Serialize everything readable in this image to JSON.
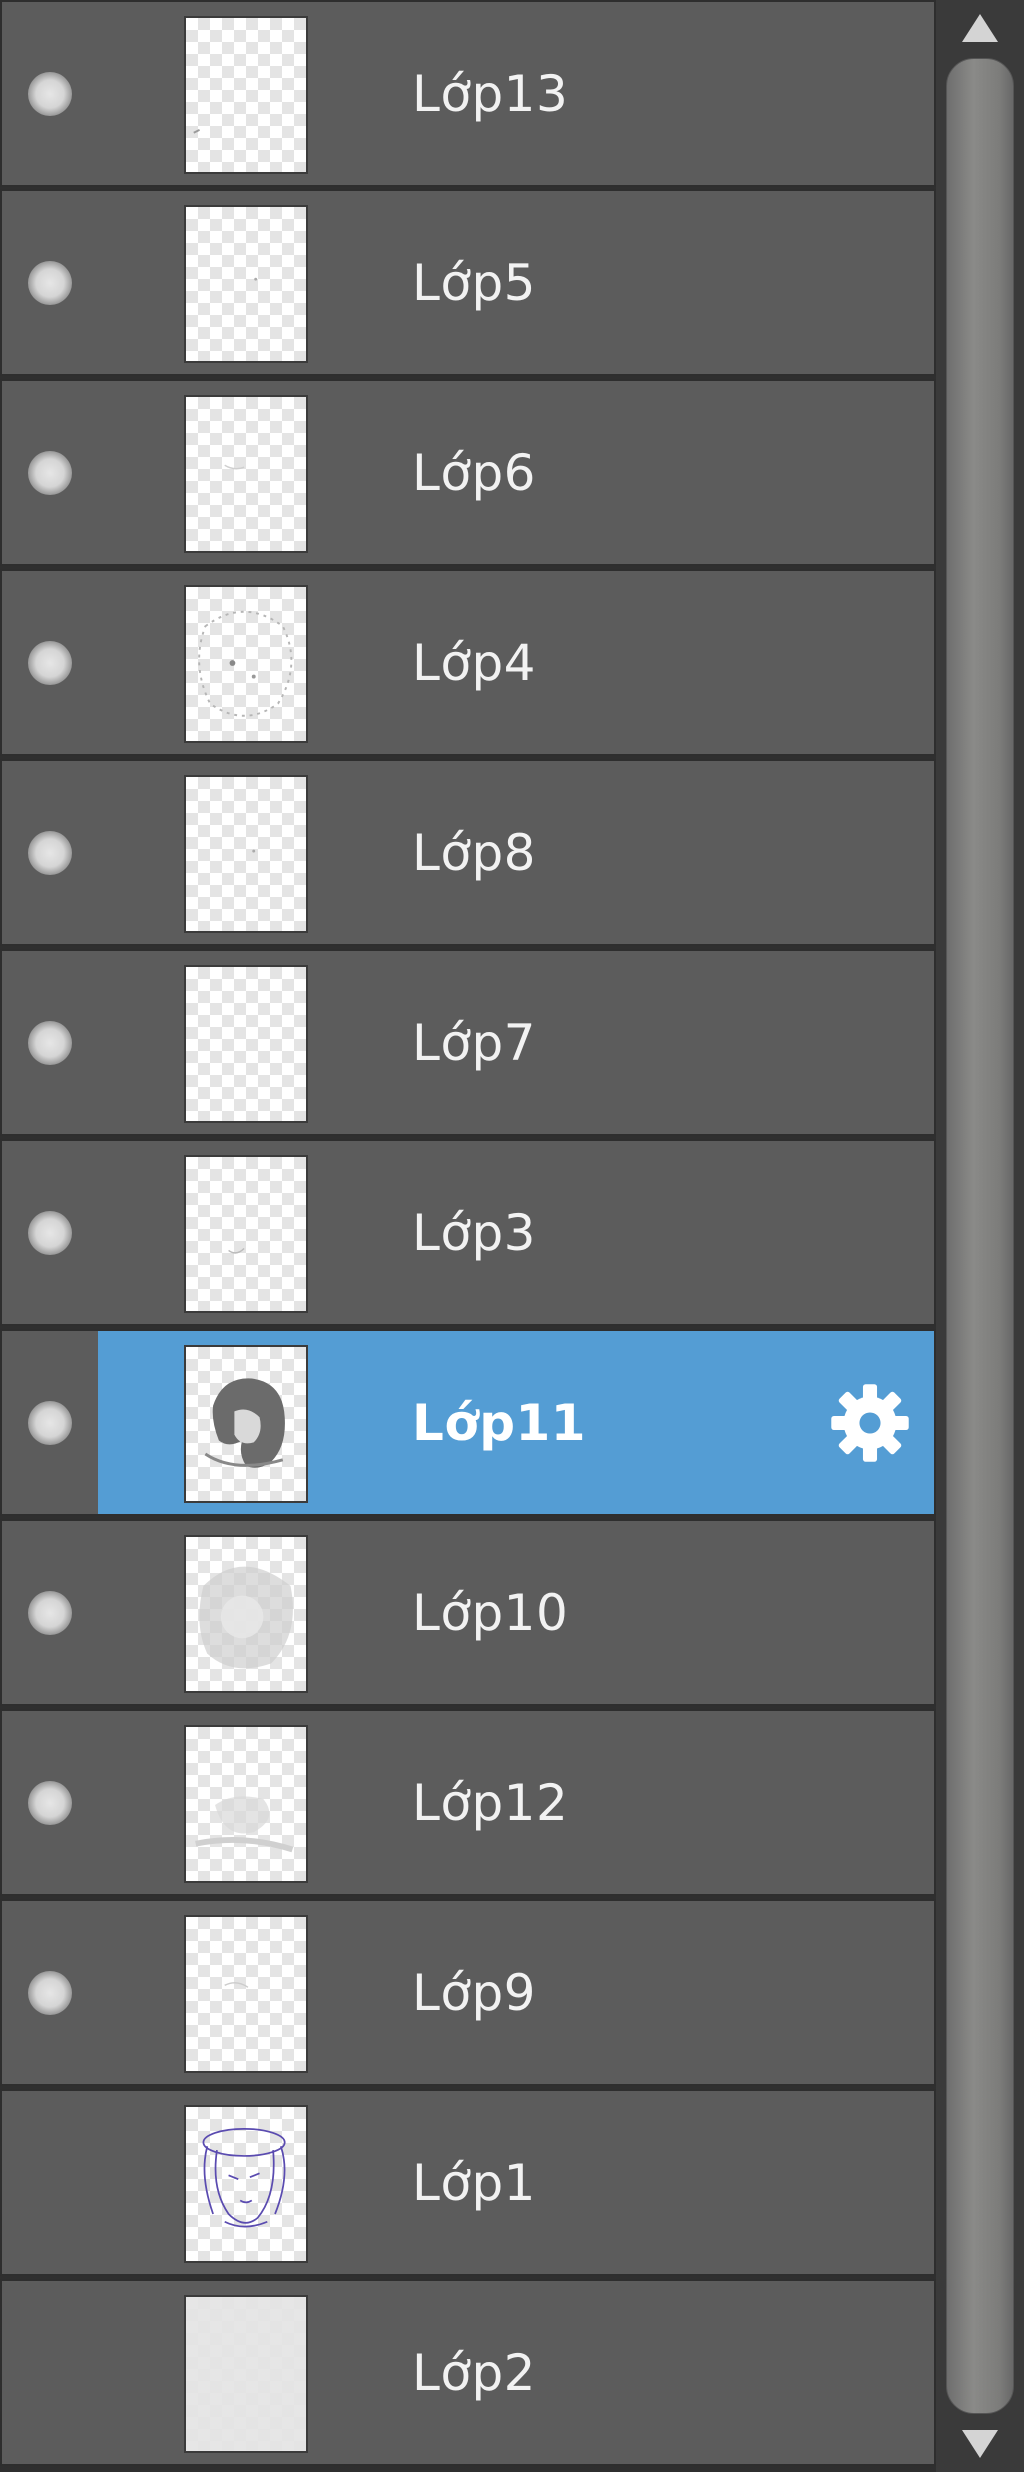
{
  "layers_panel": {
    "layers": [
      {
        "name": "Lớp13",
        "visible": true,
        "selected": false
      },
      {
        "name": "Lớp5",
        "visible": true,
        "selected": false
      },
      {
        "name": "Lớp6",
        "visible": true,
        "selected": false
      },
      {
        "name": "Lớp4",
        "visible": true,
        "selected": false
      },
      {
        "name": "Lớp8",
        "visible": true,
        "selected": false
      },
      {
        "name": "Lớp7",
        "visible": true,
        "selected": false
      },
      {
        "name": "Lớp3",
        "visible": true,
        "selected": false
      },
      {
        "name": "Lớp11",
        "visible": true,
        "selected": true
      },
      {
        "name": "Lớp10",
        "visible": true,
        "selected": false
      },
      {
        "name": "Lớp12",
        "visible": true,
        "selected": false
      },
      {
        "name": "Lớp9",
        "visible": true,
        "selected": false
      },
      {
        "name": "Lớp1",
        "visible": false,
        "selected": false
      },
      {
        "name": "Lớp2",
        "visible": false,
        "selected": false
      }
    ],
    "icons": {
      "visibility": "eye-dot-icon",
      "settings": "gear-icon",
      "scroll_up": "triangle-up-icon",
      "scroll_down": "triangle-down-icon"
    },
    "colors": {
      "row_bg": "#5c5c5c",
      "selected_bg": "#549dd4",
      "text": "#f2f2f2"
    }
  }
}
